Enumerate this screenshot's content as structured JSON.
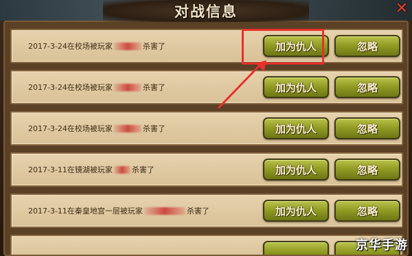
{
  "dialog": {
    "title": "对战信息"
  },
  "rows": [
    {
      "pre": "2017-3-24在校场被玩家",
      "post": "杀害了",
      "censor": "normal",
      "top": 0
    },
    {
      "pre": "2017-3-24在校场被玩家",
      "post": "杀害了",
      "censor": "normal"
    },
    {
      "pre": "2017-3-24在校场被玩家",
      "post": "杀害了",
      "censor": "normal"
    },
    {
      "pre": "2017-3-11在镜湖被玩家",
      "post": "杀害了",
      "censor": "small"
    },
    {
      "pre": "2017-3-11在秦皇地宫一层被玩家",
      "post": "杀害了",
      "censor": "wide"
    }
  ],
  "buttons": {
    "enemy": "加为仇人",
    "ignore": "忽略"
  },
  "watermark": "京华手游",
  "colors": {
    "highlight": "#e8302c",
    "button": "#8f9a22",
    "row_bg": "#e6d2ad"
  }
}
